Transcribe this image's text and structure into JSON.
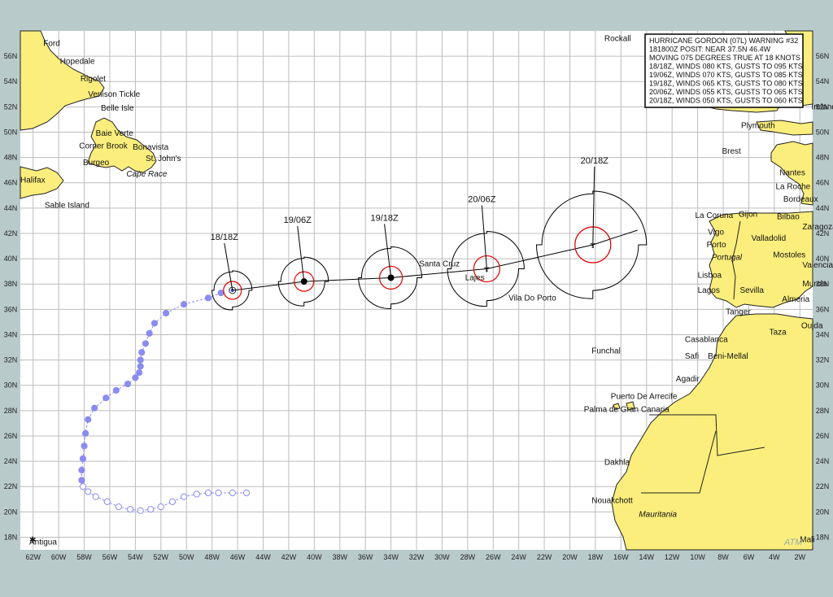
{
  "map": {
    "lon_range": [
      -63,
      -1
    ],
    "lat_range": [
      17,
      58
    ],
    "grid_step_deg": 2,
    "longitude_labels": [
      "62W",
      "60W",
      "58W",
      "56W",
      "54W",
      "52W",
      "50W",
      "48W",
      "46W",
      "44W",
      "42W",
      "40W",
      "38W",
      "36W",
      "34W",
      "32W",
      "30W",
      "28W",
      "26W",
      "24W",
      "22W",
      "20W",
      "18W",
      "16W",
      "14W",
      "12W",
      "10W",
      "8W",
      "6W",
      "4W",
      "2W"
    ],
    "latitude_labels": [
      "56N",
      "54N",
      "52N",
      "50N",
      "48N",
      "46N",
      "44N",
      "42N",
      "40N",
      "38N",
      "36N",
      "34N",
      "32N",
      "30N",
      "28N",
      "26N",
      "24N",
      "22N",
      "20N",
      "18N"
    ],
    "colors": {
      "ocean": "#ffffff",
      "land": "#fbee7c",
      "frame": "#b9cacb",
      "grid": "#bcbcbc",
      "past_track": "#8a8cf0",
      "wind_radius_34kt": "#000000",
      "wind_radius_64kt": "#e00000"
    },
    "watermark": "ATM"
  },
  "warning": {
    "lines": [
      "HURRICANE GORDON (07L) WARNING #32",
      "181800Z POSIT: NEAR 37.5N 46.4W",
      "MOVING 075 DEGREES TRUE AT 18 KNOTS",
      "18/18Z, WINDS 080 KTS, GUSTS TO 095 KTS",
      "19/06Z, WINDS 070 KTS, GUSTS TO 085 KTS",
      "19/18Z, WINDS 065 KTS, GUSTS TO 080 KTS",
      "20/06Z, WINDS 055 KTS, GUSTS TO 065 KTS",
      "20/18Z, WINDS 050 KTS, GUSTS TO 060 KTS"
    ]
  },
  "forecast_points": [
    {
      "label": "18/18Z",
      "lat": 37.5,
      "lon": -46.4
    },
    {
      "label": "19/06Z",
      "lat": 38.2,
      "lon": -40.8
    },
    {
      "label": "19/18Z",
      "lat": 38.5,
      "lon": -34.0
    },
    {
      "label": "20/06Z",
      "lat": 39.2,
      "lon": -26.5
    },
    {
      "label": "20/18Z",
      "lat": 41.1,
      "lon": -18.2
    }
  ],
  "past_track": [
    {
      "lat": 21.5,
      "lon": -45.3
    },
    {
      "lat": 21.5,
      "lon": -46.4
    },
    {
      "lat": 21.5,
      "lon": -47.5
    },
    {
      "lat": 21.5,
      "lon": -48.3
    },
    {
      "lat": 21.4,
      "lon": -49.2
    },
    {
      "lat": 21.2,
      "lon": -50.2
    },
    {
      "lat": 20.8,
      "lon": -51.1
    },
    {
      "lat": 20.4,
      "lon": -52.0
    },
    {
      "lat": 20.2,
      "lon": -52.8
    },
    {
      "lat": 20.1,
      "lon": -53.6
    },
    {
      "lat": 20.2,
      "lon": -54.4
    },
    {
      "lat": 20.4,
      "lon": -55.3
    },
    {
      "lat": 20.8,
      "lon": -56.2
    },
    {
      "lat": 21.2,
      "lon": -57.1
    },
    {
      "lat": 21.6,
      "lon": -57.7
    },
    {
      "lat": 22.0,
      "lon": -58.1
    },
    {
      "lat": 22.5,
      "lon": -58.2
    },
    {
      "lat": 23.3,
      "lon": -58.2
    },
    {
      "lat": 24.2,
      "lon": -58.1
    },
    {
      "lat": 25.2,
      "lon": -58.0
    },
    {
      "lat": 26.2,
      "lon": -57.9
    },
    {
      "lat": 27.3,
      "lon": -57.7
    },
    {
      "lat": 28.2,
      "lon": -57.2
    },
    {
      "lat": 29.0,
      "lon": -56.3
    },
    {
      "lat": 29.6,
      "lon": -55.5
    },
    {
      "lat": 30.1,
      "lon": -54.6
    },
    {
      "lat": 30.6,
      "lon": -54.0
    },
    {
      "lat": 31.0,
      "lon": -53.7
    },
    {
      "lat": 31.5,
      "lon": -53.6
    },
    {
      "lat": 32.0,
      "lon": -53.6
    },
    {
      "lat": 32.6,
      "lon": -53.5
    },
    {
      "lat": 33.3,
      "lon": -53.2
    },
    {
      "lat": 34.1,
      "lon": -52.9
    },
    {
      "lat": 34.9,
      "lon": -52.5
    },
    {
      "lat": 35.7,
      "lon": -51.6
    },
    {
      "lat": 36.4,
      "lon": -50.2
    },
    {
      "lat": 36.9,
      "lon": -48.3
    },
    {
      "lat": 37.3,
      "lon": -47.3
    }
  ],
  "places": [
    {
      "name": "Ford",
      "lat": 57.0,
      "lon": -61.2
    },
    {
      "name": "Hopedale",
      "lat": 55.6,
      "lon": -59.9
    },
    {
      "name": "Rigolet",
      "lat": 54.2,
      "lon": -58.3
    },
    {
      "name": "Venison Tickle",
      "lat": 53.0,
      "lon": -57.7
    },
    {
      "name": "Belle Isle",
      "lat": 51.9,
      "lon": -56.7
    },
    {
      "name": "Baie Verte",
      "lat": 49.9,
      "lon": -57.1
    },
    {
      "name": "Corner Brook",
      "lat": 48.9,
      "lon": -58.4
    },
    {
      "name": "Bonavista",
      "lat": 48.8,
      "lon": -54.2
    },
    {
      "name": "St. John's",
      "lat": 47.9,
      "lon": -53.2
    },
    {
      "name": "Burgeo",
      "lat": 47.6,
      "lon": -58.1
    },
    {
      "name": "Halifax",
      "lat": 46.2,
      "lon": -63.0
    },
    {
      "name": "Sable Island",
      "lat": 44.2,
      "lon": -61.1
    },
    {
      "name": "Santa Cruz",
      "lat": 39.6,
      "lon": -31.8
    },
    {
      "name": "Lajes",
      "lat": 38.5,
      "lon": -28.2
    },
    {
      "name": "Vila Do Porto",
      "lat": 36.9,
      "lon": -24.8
    },
    {
      "name": "Funchal",
      "lat": 32.7,
      "lon": -18.3
    },
    {
      "name": "Puerto De Arrecife",
      "lat": 29.1,
      "lon": -16.8
    },
    {
      "name": "Palma de Gran Canaria",
      "lat": 28.1,
      "lon": -18.9
    },
    {
      "name": "Dakhla",
      "lat": 23.9,
      "lon": -17.3
    },
    {
      "name": "Nouakchott",
      "lat": 20.9,
      "lon": -18.3
    },
    {
      "name": "Antigua",
      "lat": 17.6,
      "lon": -62.3
    },
    {
      "name": "Rockall",
      "lat": 57.4,
      "lon": -17.3
    },
    {
      "name": "Plymouth",
      "lat": 50.5,
      "lon": -6.6
    },
    {
      "name": "Brest",
      "lat": 48.5,
      "lon": -8.1
    },
    {
      "name": "Nantes",
      "lat": 46.8,
      "lon": -3.6
    },
    {
      "name": "La Roche",
      "lat": 45.7,
      "lon": -3.9
    },
    {
      "name": "Bordeaux",
      "lat": 44.7,
      "lon": -3.3
    },
    {
      "name": "La Coruna",
      "lat": 43.4,
      "lon": -10.2
    },
    {
      "name": "Gijon",
      "lat": 43.5,
      "lon": -6.8
    },
    {
      "name": "Bilbao",
      "lat": 43.3,
      "lon": -3.8
    },
    {
      "name": "Zaragoza",
      "lat": 42.5,
      "lon": -1.8
    },
    {
      "name": "Vigo",
      "lat": 42.1,
      "lon": -9.2
    },
    {
      "name": "Valladolid",
      "lat": 41.6,
      "lon": -5.8
    },
    {
      "name": "Porto",
      "lat": 41.1,
      "lon": -9.3
    },
    {
      "name": "Mostoles",
      "lat": 40.3,
      "lon": -4.1
    },
    {
      "name": "Valencia",
      "lat": 39.5,
      "lon": -1.8
    },
    {
      "name": "Lisboa",
      "lat": 38.7,
      "lon": -10.0
    },
    {
      "name": "Murcia",
      "lat": 38.0,
      "lon": -1.8
    },
    {
      "name": "Sevilla",
      "lat": 37.5,
      "lon": -6.7
    },
    {
      "name": "Lagos",
      "lat": 37.5,
      "lon": -10.0
    },
    {
      "name": "Almeria",
      "lat": 36.8,
      "lon": -3.4
    },
    {
      "name": "Tanger",
      "lat": 35.8,
      "lon": -7.8
    },
    {
      "name": "Oujda",
      "lat": 34.7,
      "lon": -1.9
    },
    {
      "name": "Taza",
      "lat": 34.2,
      "lon": -4.4
    },
    {
      "name": "Casablanca",
      "lat": 33.6,
      "lon": -11.0
    },
    {
      "name": "Safi",
      "lat": 32.3,
      "lon": -11.0
    },
    {
      "name": "Beni-Mellal",
      "lat": 32.3,
      "lon": -9.2
    },
    {
      "name": "Agadir",
      "lat": 30.5,
      "lon": -11.7
    },
    {
      "name": "Ireland",
      "lat": 52.0,
      "lon": -1.1
    },
    {
      "name": "Mali",
      "lat": 17.8,
      "lon": -2.0
    }
  ],
  "country_labels": [
    {
      "name": "Portugal",
      "lat": 40.1,
      "lon": -8.9
    },
    {
      "name": "Mauritania",
      "lat": 19.8,
      "lon": -14.6
    },
    {
      "name": "Cape Race",
      "lat": 46.7,
      "lon": -54.7
    }
  ]
}
